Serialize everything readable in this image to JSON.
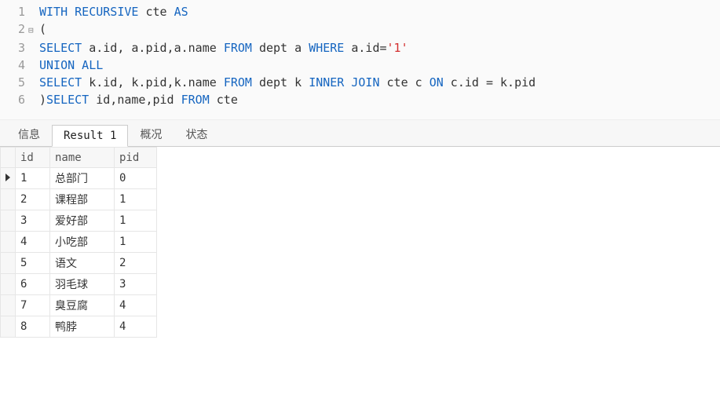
{
  "editor": {
    "lines": [
      {
        "n": "1",
        "fold": "",
        "tokens": [
          {
            "t": "WITH RECURSIVE",
            "c": "kw"
          },
          {
            "t": " cte ",
            "c": "plain"
          },
          {
            "t": "AS",
            "c": "kw"
          }
        ]
      },
      {
        "n": "2",
        "fold": "⊟",
        "tokens": [
          {
            "t": "(",
            "c": "plain"
          }
        ]
      },
      {
        "n": "3",
        "fold": "",
        "tokens": [
          {
            "t": "SELECT",
            "c": "kw"
          },
          {
            "t": " a.id, a.pid,a.name ",
            "c": "plain"
          },
          {
            "t": "FROM",
            "c": "kw"
          },
          {
            "t": " dept a ",
            "c": "plain"
          },
          {
            "t": "WHERE",
            "c": "kw"
          },
          {
            "t": " a.id=",
            "c": "plain"
          },
          {
            "t": "'1'",
            "c": "str"
          }
        ]
      },
      {
        "n": "4",
        "fold": "",
        "tokens": [
          {
            "t": "UNION ALL",
            "c": "kw"
          }
        ]
      },
      {
        "n": "5",
        "fold": "",
        "tokens": [
          {
            "t": "SELECT",
            "c": "kw"
          },
          {
            "t": " k.id, k.pid,k.name ",
            "c": "plain"
          },
          {
            "t": "FROM",
            "c": "kw"
          },
          {
            "t": " dept k ",
            "c": "plain"
          },
          {
            "t": "INNER JOIN",
            "c": "kw"
          },
          {
            "t": " cte c ",
            "c": "plain"
          },
          {
            "t": "ON",
            "c": "kw"
          },
          {
            "t": " c.id = k.pid",
            "c": "plain"
          }
        ]
      },
      {
        "n": "6",
        "fold": "",
        "tokens": [
          {
            "t": ")",
            "c": "plain"
          },
          {
            "t": "SELECT",
            "c": "kw"
          },
          {
            "t": " id,name,pid ",
            "c": "plain"
          },
          {
            "t": "FROM",
            "c": "kw"
          },
          {
            "t": " cte",
            "c": "plain"
          }
        ]
      }
    ]
  },
  "tabs": {
    "items": [
      {
        "label": "信息",
        "active": false
      },
      {
        "label": "Result 1",
        "active": true
      },
      {
        "label": "概况",
        "active": false
      },
      {
        "label": "状态",
        "active": false
      }
    ]
  },
  "result": {
    "columns": [
      "id",
      "name",
      "pid"
    ],
    "rows": [
      {
        "id": "1",
        "name": "总部门",
        "pid": "0",
        "current": true
      },
      {
        "id": "2",
        "name": "课程部",
        "pid": "1",
        "current": false
      },
      {
        "id": "3",
        "name": "爱好部",
        "pid": "1",
        "current": false
      },
      {
        "id": "4",
        "name": "小吃部",
        "pid": "1",
        "current": false
      },
      {
        "id": "5",
        "name": "语文",
        "pid": "2",
        "current": false
      },
      {
        "id": "6",
        "name": "羽毛球",
        "pid": "3",
        "current": false
      },
      {
        "id": "7",
        "name": "臭豆腐",
        "pid": "4",
        "current": false
      },
      {
        "id": "8",
        "name": "鸭脖",
        "pid": "4",
        "current": false
      }
    ]
  },
  "chart_data": {
    "type": "table",
    "title": "Result 1",
    "columns": [
      "id",
      "name",
      "pid"
    ],
    "rows": [
      [
        1,
        "总部门",
        0
      ],
      [
        2,
        "课程部",
        1
      ],
      [
        3,
        "爱好部",
        1
      ],
      [
        4,
        "小吃部",
        1
      ],
      [
        5,
        "语文",
        2
      ],
      [
        6,
        "羽毛球",
        3
      ],
      [
        7,
        "臭豆腐",
        4
      ],
      [
        8,
        "鸭脖",
        4
      ]
    ]
  }
}
